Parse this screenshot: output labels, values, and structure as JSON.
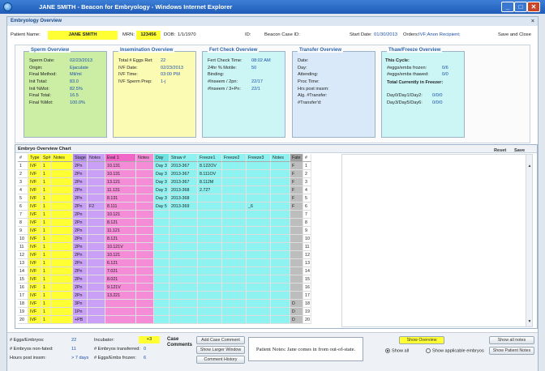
{
  "window": {
    "title": "JANE SMITH - Beacon for Embryology - Windows Internet Explorer"
  },
  "panel": {
    "title": "Embryology Overview"
  },
  "patient": {
    "name_label": "Patient Name:",
    "name": "JANE SMITH",
    "mrn_label": "MRN:",
    "mrn": "123456",
    "dob_label": "DOB:",
    "dob": "1/1/1970",
    "id_label": "ID:",
    "case_label": "Beacon Case ID:",
    "start_label": "Start Date:",
    "start": "01/30/2013",
    "orders_label": "Orders:",
    "orders": "IVF;Anon Recipient;",
    "save_close": "Save and Close"
  },
  "sperm": {
    "title": "Sperm Overview",
    "rows": [
      {
        "k": "Sperm Date:",
        "v": "02/23/2013"
      },
      {
        "k": "Origin:",
        "v": "Ejaculate"
      },
      {
        "k": "Final Method:",
        "v": "Mil/ml"
      },
      {
        "k": "Init Total:",
        "v": "83.0"
      },
      {
        "k": "Init %Mot:",
        "v": "82.5%"
      },
      {
        "k": "Final Total:",
        "v": "16.5"
      },
      {
        "k": "Final %Mot:",
        "v": "100.0%"
      }
    ]
  },
  "insemination": {
    "title": "Insemination Overview",
    "rows": [
      {
        "k": "Total # Eggs Ret:",
        "v": "22"
      },
      {
        "k": "IVF Date:",
        "v": "02/23/2013"
      },
      {
        "k": "IVF Time:",
        "v": "03:00 PM"
      },
      {
        "k": "IVF Sperm Prep:",
        "v": "1-j"
      }
    ]
  },
  "fert": {
    "title": "Fert Check Overview",
    "rows": [
      {
        "k": "Fert Check Time:",
        "v": "08:02 AM"
      },
      {
        "k": "24hr % Motile:",
        "v": "50"
      },
      {
        "k": "Binding:",
        "v": ""
      },
      {
        "k": "#Inseem / 2pn:",
        "v": "22/17"
      },
      {
        "k": "#Inseem / 3+Pn:",
        "v": "22/1"
      }
    ]
  },
  "transfer": {
    "title": "Transfer Overview",
    "rows": [
      {
        "k": "Date:",
        "v": ""
      },
      {
        "k": "Day:",
        "v": ""
      },
      {
        "k": "Attending:",
        "v": ""
      },
      {
        "k": "Proc Time:",
        "v": ""
      },
      {
        "k": "Hrs post inssm:",
        "v": ""
      },
      {
        "k": "Alg. #Transfer:",
        "v": ""
      },
      {
        "k": "#Transfer'd:",
        "v": ""
      }
    ]
  },
  "thaw": {
    "title": "Thaw/Freeze Overview",
    "cycle": "This Cycle:",
    "frozen_k": "#eggs/embs frozen:",
    "frozen_v": "0/6",
    "thawed_k": "#eggs/embs thawed:",
    "thawed_v": "0/0",
    "total": "Total Currently in Freezer:",
    "d012_k": "Day0/Day1/Day2:",
    "d012_v": "0/0/0",
    "d356_k": "Day3/Day5/Day6:",
    "d356_v": "0/0/0"
  },
  "chart": {
    "title": "Embryo Overview Chart",
    "reset": "Reset",
    "save": "Save",
    "headers": [
      "#",
      "Type",
      "Sp#",
      "Notes",
      "Stage",
      "Notes",
      "Eval 1",
      "Notes",
      "Day",
      "Straw #",
      "Freeze1",
      "Freeze2",
      "Freeze3",
      "Notes",
      "Fate",
      "#"
    ],
    "rows": [
      [
        "1",
        "IVF",
        "1",
        "",
        "2Pn",
        "",
        "10.131",
        "",
        "Day 3",
        "2013-367",
        "8.122OV",
        "",
        "",
        "",
        "F",
        "1"
      ],
      [
        "2",
        "IVF",
        "1",
        "",
        "2Pn",
        "",
        "10.131",
        "",
        "Day 3",
        "2013-367",
        "8.111OV",
        "",
        "",
        "",
        "F",
        "2"
      ],
      [
        "3",
        "IVF",
        "1",
        "",
        "2Pn",
        "",
        "13.121",
        "",
        "Day 3",
        "2013-367",
        "8.112M",
        "",
        "",
        "",
        "F",
        "3"
      ],
      [
        "4",
        "IVF",
        "1",
        "",
        "2Pn",
        "",
        "11.131",
        "",
        "Day 3",
        "2013-368",
        "2.72?",
        "",
        "",
        "",
        "F",
        "4"
      ],
      [
        "5",
        "IVF",
        "1",
        "",
        "2Pn",
        "",
        "8.131",
        "",
        "Day 3",
        "2013-368",
        "",
        "",
        "",
        "",
        "F",
        "5"
      ],
      [
        "6",
        "IVF",
        "1",
        "",
        "2Pn",
        "F2",
        "8.111",
        "",
        "Day 5",
        "2013-369",
        "",
        "",
        "_6",
        "",
        "F",
        "6"
      ],
      [
        "7",
        "IVF",
        "1",
        "",
        "2Pn",
        "",
        "10.121",
        "",
        "",
        "",
        "",
        "",
        "",
        "",
        "",
        "7"
      ],
      [
        "8",
        "IVF",
        "1",
        "",
        "2Pn",
        "",
        "8.121",
        "",
        "",
        "",
        "",
        "",
        "",
        "",
        "",
        "8"
      ],
      [
        "9",
        "IVF",
        "1",
        "",
        "2Pn",
        "",
        "11.121",
        "",
        "",
        "",
        "",
        "",
        "",
        "",
        "",
        "9"
      ],
      [
        "10",
        "IVF",
        "1",
        "",
        "2Pn",
        "",
        "8.121",
        "",
        "",
        "",
        "",
        "",
        "",
        "",
        "",
        "10"
      ],
      [
        "11",
        "IVF",
        "1",
        "",
        "2Pn",
        "",
        "10.121V",
        "",
        "",
        "",
        "",
        "",
        "",
        "",
        "",
        "11"
      ],
      [
        "12",
        "IVF",
        "1",
        "",
        "2Pn",
        "",
        "10.121",
        "",
        "",
        "",
        "",
        "",
        "",
        "",
        "",
        "12"
      ],
      [
        "13",
        "IVF",
        "1",
        "",
        "2Pn",
        "",
        "6.121",
        "",
        "",
        "",
        "",
        "",
        "",
        "",
        "",
        "13"
      ],
      [
        "14",
        "IVF",
        "1",
        "",
        "2Pn",
        "",
        "7.021",
        "",
        "",
        "",
        "",
        "",
        "",
        "",
        "",
        "14"
      ],
      [
        "15",
        "IVF",
        "1",
        "",
        "2Pn",
        "",
        "8.021",
        "",
        "",
        "",
        "",
        "",
        "",
        "",
        "",
        "15"
      ],
      [
        "16",
        "IVF",
        "1",
        "",
        "2Pn",
        "",
        "9.121V",
        "",
        "",
        "",
        "",
        "",
        "",
        "",
        "",
        "16"
      ],
      [
        "17",
        "IVF",
        "1",
        "",
        "2Pn",
        "",
        "13.221",
        "",
        "",
        "",
        "",
        "",
        "",
        "",
        "",
        "17"
      ],
      [
        "18",
        "IVF",
        "1",
        "",
        "3Pn",
        "",
        "",
        "",
        "",
        "",
        "",
        "",
        "",
        "",
        "D",
        "18"
      ],
      [
        "19",
        "IVF",
        "1",
        "",
        "1Pn",
        "",
        "",
        "",
        "",
        "",
        "",
        "",
        "",
        "",
        "D",
        "19"
      ],
      [
        "20",
        "IVF",
        "1",
        "",
        "+PB",
        "",
        "",
        "",
        "",
        "",
        "",
        "",
        "",
        "",
        "D",
        "20"
      ]
    ]
  },
  "footer": {
    "eggs_k": "# Eggs/Embryos:",
    "eggs_v": "22",
    "nonfated_k": "# Embryos non-fated:",
    "nonfated_v": "11",
    "hours_k": "Hours post inssm:",
    "hours_v": "> 7 days",
    "incubator_k": "Incubator:",
    "incubator_v": "+3",
    "transferred_k": "# Embryos transferred:",
    "transferred_v": "0",
    "frozen_k": "# Eggs/Embs frozen:",
    "frozen_v": "6",
    "case_comments": "Case Comments",
    "add_comment": "Add Case Comment",
    "show_larger": "Show Larger Window",
    "comment_history": "Comment History",
    "patient_notes": "Patient Notes: Jane comes in from out-of-state.",
    "show_overview": "Show Overview",
    "show_all": "Show all",
    "show_applicable": "Show applicable embryos",
    "show_all_notes": "Show all notes",
    "show_patient_notes": "Show Patient Notes"
  },
  "colors": {
    "yellow": "#ffff33",
    "purple": "#c9a0f5",
    "pink": "#f58cd8",
    "cyan": "#8ef2f0",
    "gray": "#bdbdbd",
    "green_box": "#cbeea4",
    "yellow_box": "#fbfbb4",
    "cyan_box": "#ccf6f6",
    "blue_box": "#d9e9f9"
  }
}
